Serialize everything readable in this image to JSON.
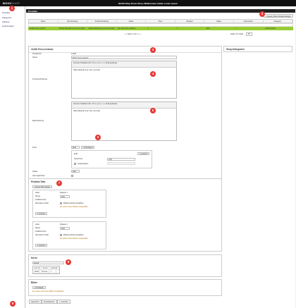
{
  "app": {
    "logo_main": "BOXX",
    "logo_rest": "SHOP",
    "title": "BOXX-Shop Demo Shop, Willkommen Admin Lorem ipsum"
  },
  "sidebar": {
    "items": [
      {
        "label": "Produkte"
      },
      {
        "label": "Kategorien"
      },
      {
        "label": "Attribute"
      },
      {
        "label": "Lieferzustand"
      }
    ]
  },
  "list": {
    "header_title": "Produkte",
    "new_button": "+ Neues Shop-Produkt anlegen",
    "columns": [
      "Name",
      "Beschreibung",
      "Kurzbeschreibung",
      "Status",
      "Preis",
      "Bestand",
      "Marke",
      "Preisverlauf",
      "Kategorie"
    ],
    "row": [
      "11446 Test-Lernbuch",
      "Default Standard ist ernst und klein",
      "Default Standard ist ernst und klein",
      "Ein Test Grün erscheint",
      "1",
      "1",
      "Aktiv",
      "—",
      "Lieferzustand"
    ],
    "pager": "« ‹ Seite 1 von 1 › »",
    "per_page_label": "Zeilen pro Seite:",
    "per_page_value": "20"
  },
  "form": {
    "title": "11446 Test-Lernbuch",
    "product_id_label": "Produkt-ID",
    "product_id_value": "11446",
    "name_label": "Name",
    "name_value": "BOXX Test Lernbuch",
    "short_desc_label": "Kurzbeschreibung",
    "desc_label": "Beschreibung",
    "editor_toolbar": "Format ▾  Schriftart ▾  B I U S x² x₂ ¶ ≡ ≡ ≡ ≡ ⊞ ⊞ Quellcode",
    "editor_text": "Hallo Weltwelt ist ein Text, und zwar",
    "price_label": "Preis",
    "price_value": "EUR",
    "add_price_button": "+ Hinzufügen",
    "price_currency": "EUR",
    "price_remove": "✕ Löschen",
    "price_netto_label": "Netto-Preis",
    "price_netto_value": "0,00",
    "price_brutto_label": "Angebotspreis",
    "status_label": "Status",
    "status_value": "Aktiv",
    "visible_label": "Hervorgehoben"
  },
  "shop_categories": {
    "title": "Shop-Kategorien"
  },
  "product_info": {
    "title": "Produkt-Tabs",
    "new_tab_button": "+ Neues Tab anlegen",
    "tabs": [
      {
        "label_a": "Label",
        "val_a": "Register 1",
        "label_b": "Klasse",
        "val_b": "Aktiv",
        "label_c": "Inhalt/Kurzinfo",
        "label_d": "Alternativer Inhalt",
        "check_text": "Effektive Extras auswählen",
        "warn_text": "Es wurden keine Dateien ausgewählt",
        "remove": "✕ Löschen"
      },
      {
        "label_a": "Label",
        "val_a": "Register 2",
        "label_b": "Klasse",
        "val_b": "Aktiv",
        "label_c": "Inhalt/Kurzinfo",
        "label_d": "Alternativer Inhalt",
        "check_text": "Effektive Extras auswählen",
        "warn_text": "Es wurden keine Dateien ausgewählt",
        "remove": "✕ Löschen"
      }
    ]
  },
  "courses": {
    "title": "Kurse",
    "select_value": "Aktuell",
    "columns": [
      "Kurs-ID",
      "Termin",
      "Lehrkraft"
    ],
    "row": [
      "11446",
      "Termine",
      "✎"
    ]
  },
  "images": {
    "title": "Bilder",
    "add_button": "+ Hochladen",
    "warn_text": "Es wurden noch keine Bilder hochgeladen"
  },
  "footer": {
    "save": "Speichern",
    "back": "Zurücksetzen",
    "cancel": "✕ Löschen"
  },
  "badges": [
    "1",
    "2",
    "3",
    "4",
    "5",
    "6",
    "7",
    "8",
    "9"
  ],
  "colors": {
    "accent_row": "#99cc33",
    "badge": "#e53935",
    "topbar": "#111111"
  }
}
